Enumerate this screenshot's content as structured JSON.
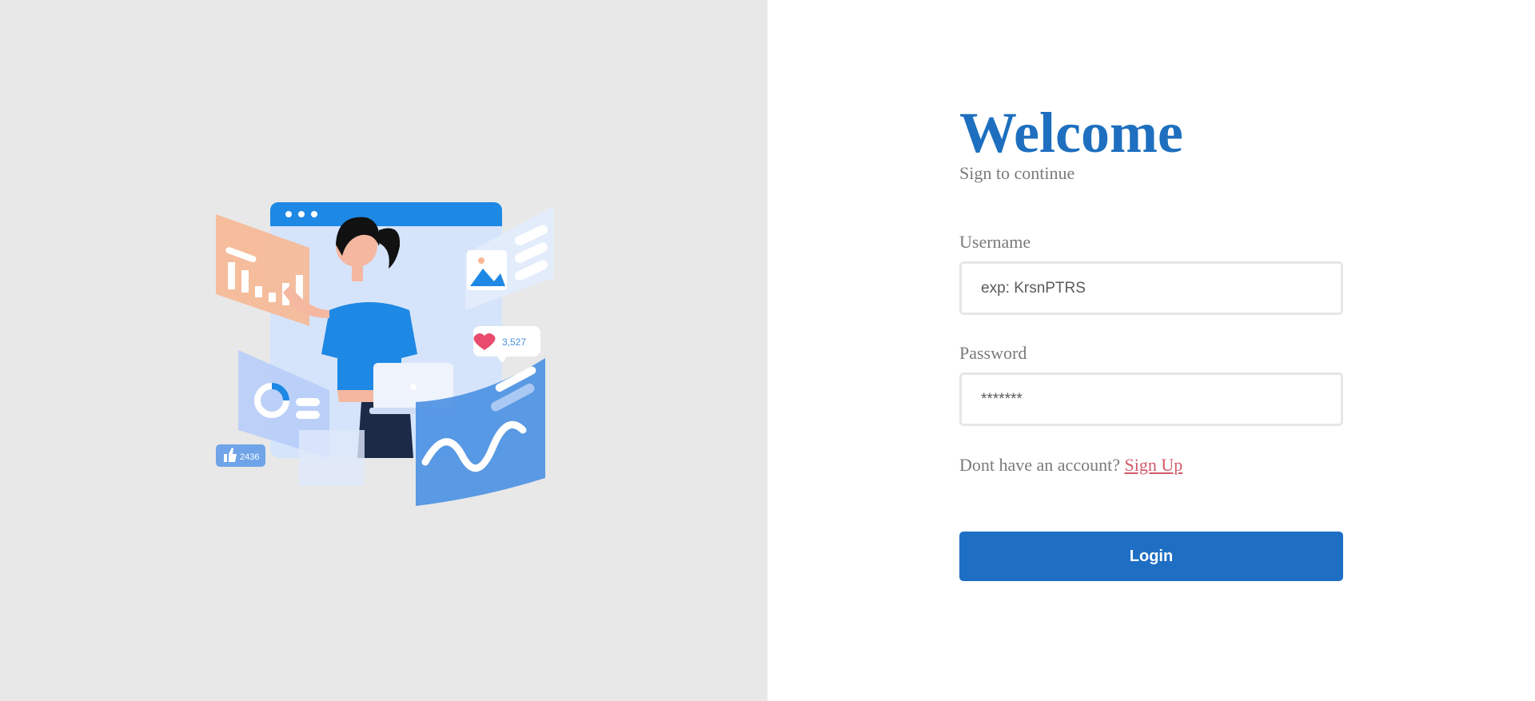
{
  "login": {
    "title": "Welcome",
    "subtitle": "Sign to continue",
    "username_label": "Username",
    "username_placeholder": "exp: KrsnPTRS",
    "password_label": "Password",
    "password_placeholder": "*******",
    "signup_prompt": "Dont have an account?",
    "signup_link": "Sign Up",
    "login_button": "Login"
  },
  "illustration": {
    "likes_count": "3,527",
    "thumbs_count": "2436"
  },
  "colors": {
    "accent": "#1e6fc4",
    "link": "#d05a6a",
    "left_background": "#e8e8e8"
  }
}
